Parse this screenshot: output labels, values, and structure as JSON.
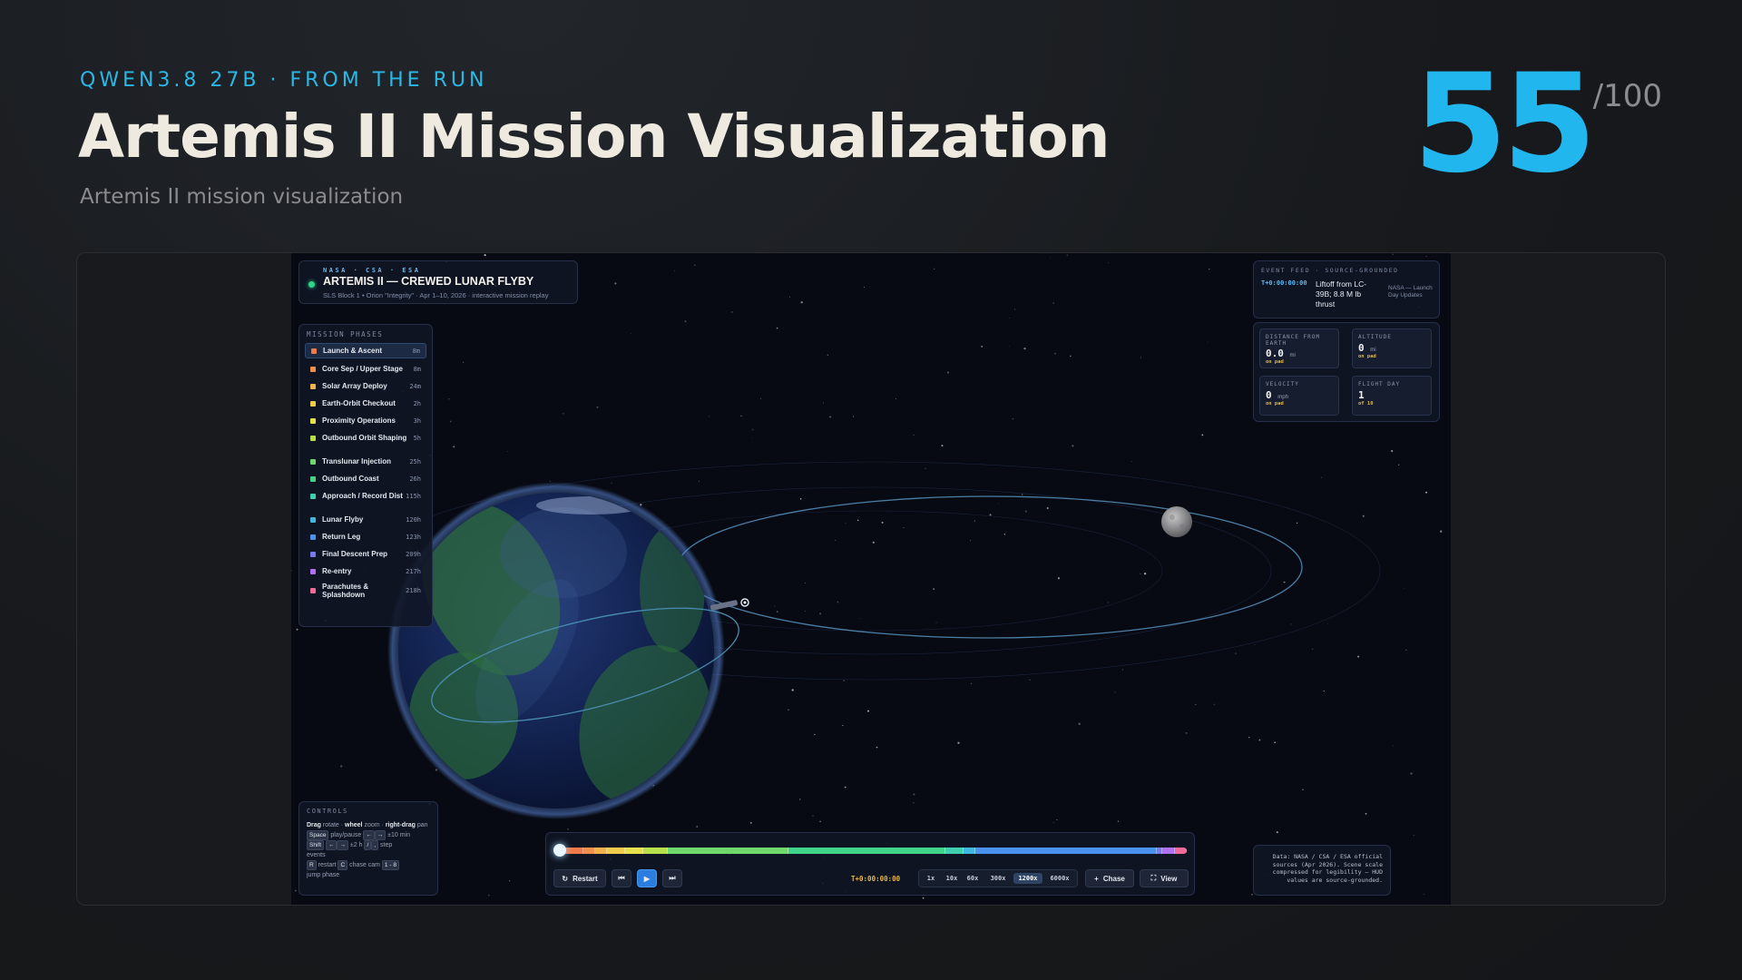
{
  "header": {
    "eyebrow": "QWEN3.8 27B · FROM THE RUN",
    "title": "Artemis II Mission Visualization",
    "subtitle": "Artemis II mission visualization",
    "score": "55",
    "score_max": "/100"
  },
  "app": {
    "agency": "NASA · CSA · ESA",
    "mission_name": "ARTEMIS II — CREWED LUNAR FLYBY",
    "mission_sub": "SLS Block 1 • Orion \"Integrity\" · Apr 1–10, 2026 · interactive mission replay"
  },
  "phases": {
    "title": "MISSION PHASES",
    "items": [
      {
        "label": "Launch & Ascent",
        "dur": "8m",
        "color": "#f07a4a",
        "active": true
      },
      {
        "label": "Core Sep / Upper Stage",
        "dur": "8m",
        "color": "#f0904a"
      },
      {
        "label": "Solar Array Deploy",
        "dur": "24m",
        "color": "#f0b24a"
      },
      {
        "label": "Earth-Orbit Checkout",
        "dur": "2h",
        "color": "#f0cc4a"
      },
      {
        "label": "Proximity Operations",
        "dur": "3h",
        "color": "#e6e04a"
      },
      {
        "label": "Outbound Orbit Shaping",
        "dur": "5h",
        "color": "#b8e04a"
      },
      {
        "label": "Translunar Injection",
        "dur": "25h",
        "color": "#6ed86a"
      },
      {
        "label": "Outbound Coast",
        "dur": "26h",
        "color": "#3fd48a"
      },
      {
        "label": "Approach / Record Dist",
        "dur": "115h",
        "color": "#3fcfae"
      },
      {
        "label": "Lunar Flyby",
        "dur": "120h",
        "color": "#3fb8e0"
      },
      {
        "label": "Return Leg",
        "dur": "123h",
        "color": "#4a92f0"
      },
      {
        "label": "Final Descent Prep",
        "dur": "209h",
        "color": "#7a7af0"
      },
      {
        "label": "Re-entry",
        "dur": "217h",
        "color": "#b070f0"
      },
      {
        "label": "Parachutes & Splashdown",
        "dur": "218h",
        "color": "#f06a9a"
      }
    ]
  },
  "controls": {
    "title": "CONTROLS",
    "drag": "Drag",
    "rotate": "rotate ·",
    "wheel": "wheel",
    "zoom": "zoom ·",
    "rightdrag": "right-drag",
    "pan": "pan",
    "space_key": "Space",
    "playpause": "play/pause",
    "arrow_left": "←",
    "arrow_right": "→",
    "plus10": "±10 min",
    "shift_key": "Shift",
    "plus2h": "±2 h",
    "bracket_l": "/",
    "bracket_r": ",",
    "step": "step",
    "events": "events",
    "r_key": "R",
    "restart": "restart",
    "c_key": "C",
    "chasecam": "chase cam",
    "num_key": "1 - 8",
    "jump": "jump phase"
  },
  "feed": {
    "title": "EVENT FEED · SOURCE-GROUNDED",
    "time": "T+0:00:00:00",
    "text": "Liftoff from LC-39B; 8.8 M lb thrust",
    "source": "NASA — Launch Day Updates"
  },
  "stats": [
    {
      "label": "DISTANCE FROM EARTH",
      "value": "0.0",
      "unit": "mi",
      "sub": "on pad"
    },
    {
      "label": "ALTITUDE",
      "value": "0",
      "unit": "mi",
      "sub": "on pad"
    },
    {
      "label": "VELOCITY",
      "value": "0",
      "unit": "mph",
      "sub": "on pad"
    },
    {
      "label": "FLIGHT DAY",
      "value": "1",
      "unit": "",
      "sub": "of 10"
    }
  ],
  "timeline": {
    "restart_label": "Restart",
    "prev_icon": "skip-back-icon",
    "play_icon": "play-icon",
    "next_icon": "skip-forward-icon",
    "time": "T+0:00:00:00",
    "speeds": [
      "1x",
      "10x",
      "60x",
      "300x",
      "1200x",
      "6000x"
    ],
    "active_speed": "1200x",
    "chase_label": "Chase",
    "view_label": "View",
    "progress": 0.0
  },
  "credits": {
    "text": "Data: NASA / CSA / ESA official sources (Apr 2026). Scene scale compressed for legibility — HUD values are source-grounded."
  }
}
